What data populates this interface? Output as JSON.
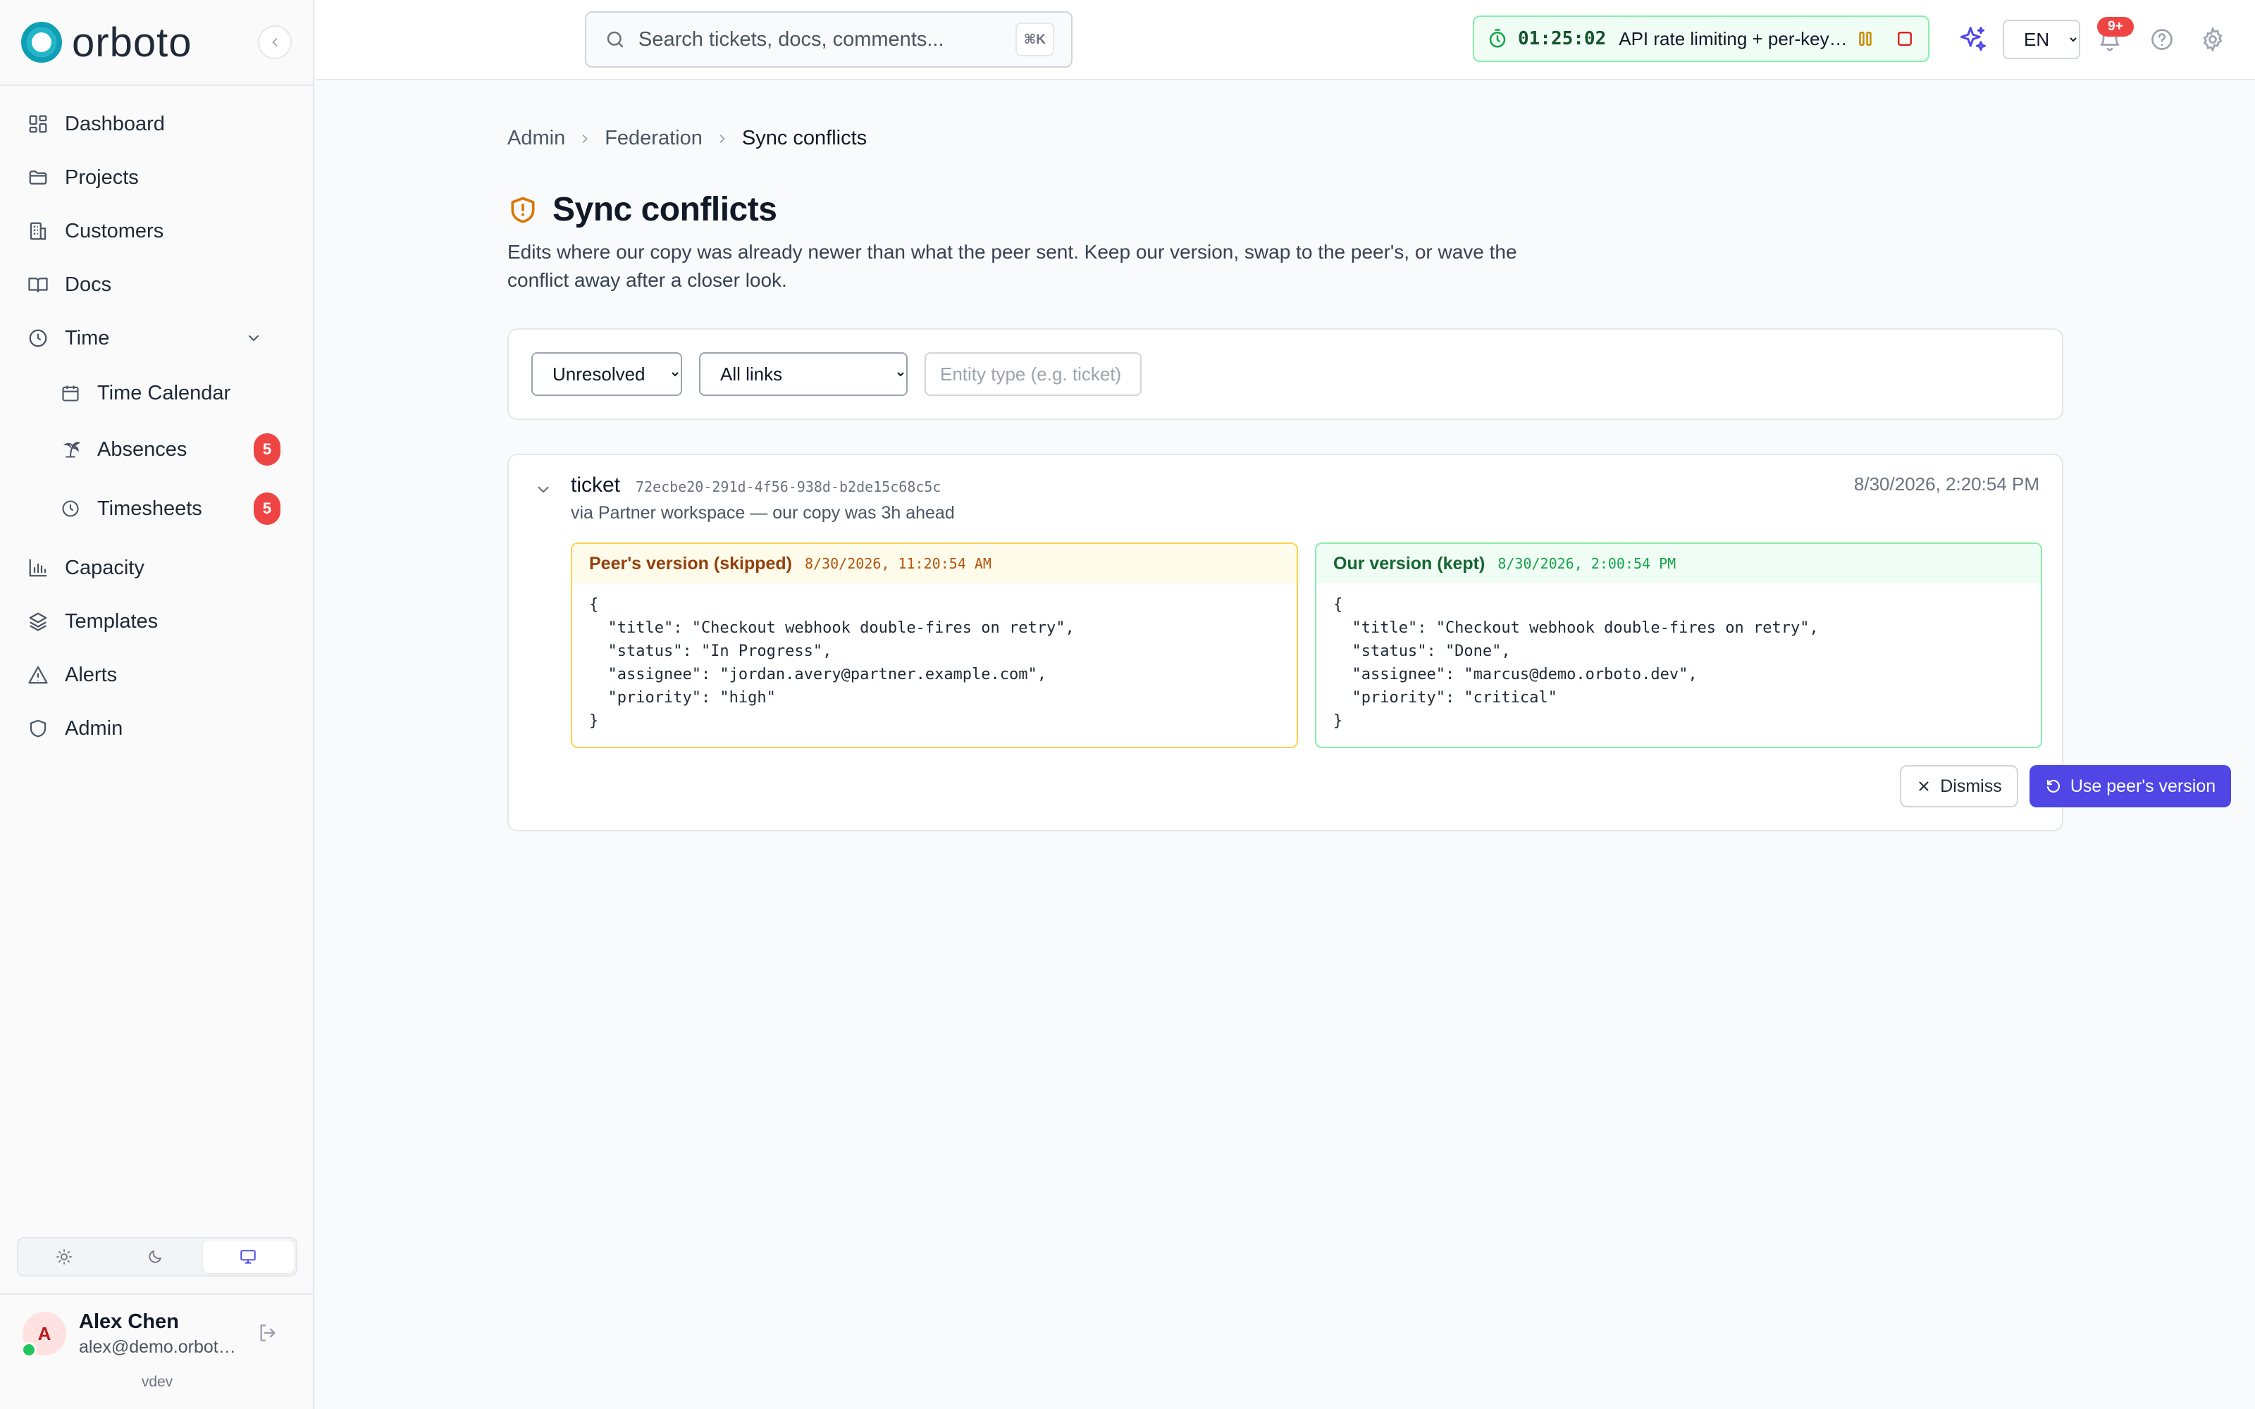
{
  "brand": {
    "name": "orboto"
  },
  "sidebar": {
    "items": [
      {
        "label": "Dashboard",
        "icon": "dashboard-icon"
      },
      {
        "label": "Projects",
        "icon": "folder-icon"
      },
      {
        "label": "Customers",
        "icon": "building-icon"
      },
      {
        "label": "Docs",
        "icon": "book-icon"
      },
      {
        "label": "Time",
        "icon": "clock-icon",
        "expanded": true
      },
      {
        "label": "Time Calendar",
        "icon": "calendar-icon"
      },
      {
        "label": "Absences",
        "icon": "palm-tree-icon",
        "badge": "5"
      },
      {
        "label": "Timesheets",
        "icon": "clock-icon",
        "badge": "5"
      },
      {
        "label": "Capacity",
        "icon": "bar-chart-icon"
      },
      {
        "label": "Templates",
        "icon": "layers-icon"
      },
      {
        "label": "Alerts",
        "icon": "warning-icon"
      },
      {
        "label": "Admin",
        "icon": "shield-icon"
      }
    ],
    "theme": {
      "options": [
        "light",
        "dark",
        "system"
      ],
      "active": "system"
    },
    "user": {
      "initial": "A",
      "name": "Alex Chen",
      "email": "alex@demo.orboto.dev",
      "status": "online"
    },
    "version": "vdev"
  },
  "header": {
    "search": {
      "placeholder": "Search tickets, docs, comments...",
      "shortcut": "⌘K"
    },
    "timer": {
      "elapsed": "01:25:02",
      "task": "API rate limiting + per-key quotas"
    },
    "language": "EN",
    "notifications_badge": "9+"
  },
  "breadcrumb": [
    "Admin",
    "Federation",
    "Sync conflicts"
  ],
  "page": {
    "title": "Sync conflicts",
    "description": "Edits where our copy was already newer than what the peer sent. Keep our version, swap to the peer's, or wave the conflict away after a closer look."
  },
  "filters": {
    "status": {
      "value": "Unresolved",
      "options": [
        "Unresolved"
      ]
    },
    "link": {
      "value": "All links",
      "options": [
        "All links"
      ]
    },
    "entity_type": {
      "placeholder": "Entity type (e.g. ticket)",
      "value": ""
    }
  },
  "conflicts": [
    {
      "entity_type": "ticket",
      "entity_id": "72ecbe20-291d-4f56-938d-b2de15c68c5c",
      "timestamp": "8/30/2026, 2:20:54 PM",
      "via": "via Partner workspace — our copy was 3h ahead",
      "peer": {
        "label": "Peer's version (skipped)",
        "timestamp": "8/30/2026, 11:20:54 AM",
        "json": "{\n  \"title\": \"Checkout webhook double-fires on retry\",\n  \"status\": \"In Progress\",\n  \"assignee\": \"jordan.avery@partner.example.com\",\n  \"priority\": \"high\"\n}"
      },
      "ours": {
        "label": "Our version (kept)",
        "timestamp": "8/30/2026, 2:00:54 PM",
        "json": "{\n  \"title\": \"Checkout webhook double-fires on retry\",\n  \"status\": \"Done\",\n  \"assignee\": \"marcus@demo.orboto.dev\",\n  \"priority\": \"critical\"\n}"
      },
      "actions": {
        "dismiss": "Dismiss",
        "use_peer": "Use peer's version"
      }
    }
  ],
  "colors": {
    "accent": "#4f46e5",
    "brand": "#0e9fb5",
    "badge": "#ef4444",
    "warning": "#d97706",
    "success": "#16a34a"
  }
}
